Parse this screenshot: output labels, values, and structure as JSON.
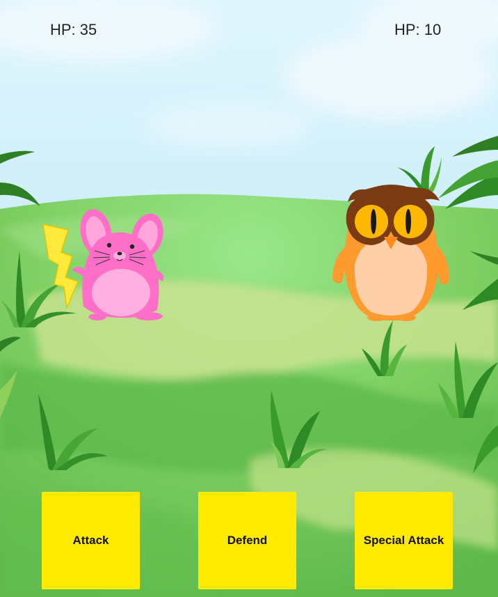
{
  "player": {
    "hp_text": "HP: 35",
    "creature": "pink-mouse"
  },
  "enemy": {
    "hp_text": "HP: 10",
    "creature": "orange-owl"
  },
  "actions": [
    {
      "label": "Attack"
    },
    {
      "label": "Defend"
    },
    {
      "label": "Special Attack"
    }
  ],
  "colors": {
    "sky_top": "#d9f3fb",
    "sky_bottom": "#b4e6f6",
    "meadow": "#7ccf5c",
    "button": "#ffea00",
    "player_body": "#ff6ec7",
    "enemy_body": "#ff9a2e"
  }
}
